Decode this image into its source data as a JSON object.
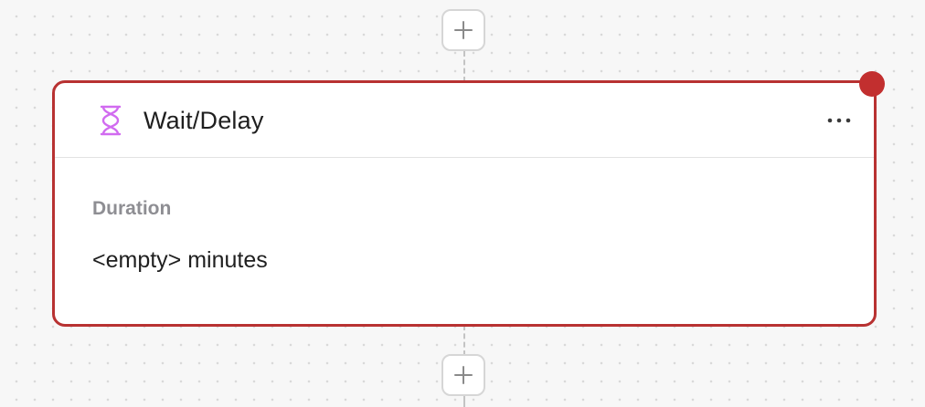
{
  "node": {
    "title": "Wait/Delay",
    "icon": "hourglass-icon",
    "duration_label": "Duration",
    "duration_value": "<empty> minutes",
    "status": "error"
  },
  "colors": {
    "error_border": "#b83232",
    "status_dot": "#c22f2f",
    "icon_accent": "#d16bf0",
    "canvas_background": "#f7f7f7"
  },
  "actions": {
    "add_step_icon": "plus-icon",
    "more_icon": "more-horizontal-icon"
  }
}
